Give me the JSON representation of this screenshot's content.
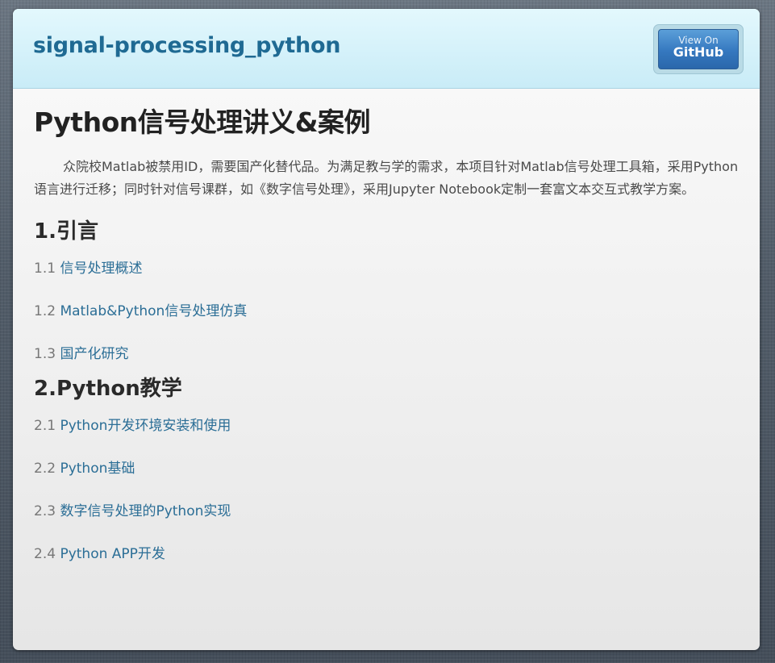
{
  "header": {
    "site_title": "signal-processing_python",
    "github_button": {
      "small_label": "View On",
      "big_label": "GitHub"
    }
  },
  "main": {
    "page_title": "Python信号处理讲义&案例",
    "intro": "众院校Matlab被禁用ID，需要国产化替代品。为满足教与学的需求，本项目针对Matlab信号处理工具箱，采用Python语言进行迁移；同时针对信号课群，如《数字信号处理》，采用Jupyter Notebook定制一套富文本交互式教学方案。",
    "sections": [
      {
        "heading": "1.引言",
        "items": [
          {
            "num": "1.1",
            "label": "信号处理概述"
          },
          {
            "num": "1.2",
            "label": "Matlab&Python信号处理仿真"
          },
          {
            "num": "1.3",
            "label": "国产化研究"
          }
        ]
      },
      {
        "heading": "2.Python教学",
        "items": [
          {
            "num": "2.1",
            "label": "Python开发环境安装和使用"
          },
          {
            "num": "2.2",
            "label": "Python基础"
          },
          {
            "num": "2.3",
            "label": "数字信号处理的Python实现"
          },
          {
            "num": "2.4",
            "label": "Python APP开发"
          }
        ]
      }
    ]
  },
  "colors": {
    "title_blue": "#1f6a93",
    "link_blue": "#2b6e96",
    "header_bg": "#d4f2fa",
    "github_blue": "#3578bf"
  }
}
